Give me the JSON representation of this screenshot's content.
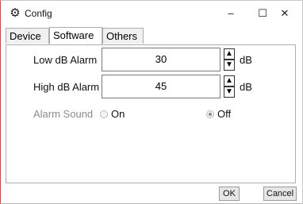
{
  "window": {
    "title": "Config",
    "icon": "gear-icon",
    "controls": {
      "minimize": "–",
      "maximize": "☐",
      "close": "✕"
    }
  },
  "tabs": [
    {
      "label": "Device",
      "active": false
    },
    {
      "label": "Software",
      "active": true
    },
    {
      "label": "Others",
      "active": false
    }
  ],
  "software": {
    "low_db": {
      "label": "Low dB Alarm",
      "value": "30",
      "unit": "dB"
    },
    "high_db": {
      "label": "High dB Alarm",
      "value": "45",
      "unit": "dB"
    },
    "alarm_sound": {
      "label": "Alarm Sound",
      "enabled": false,
      "options": [
        {
          "label": "On",
          "selected": false
        },
        {
          "label": "Off",
          "selected": true
        }
      ]
    }
  },
  "buttons": {
    "ok": "OK",
    "cancel": "Cancel"
  }
}
